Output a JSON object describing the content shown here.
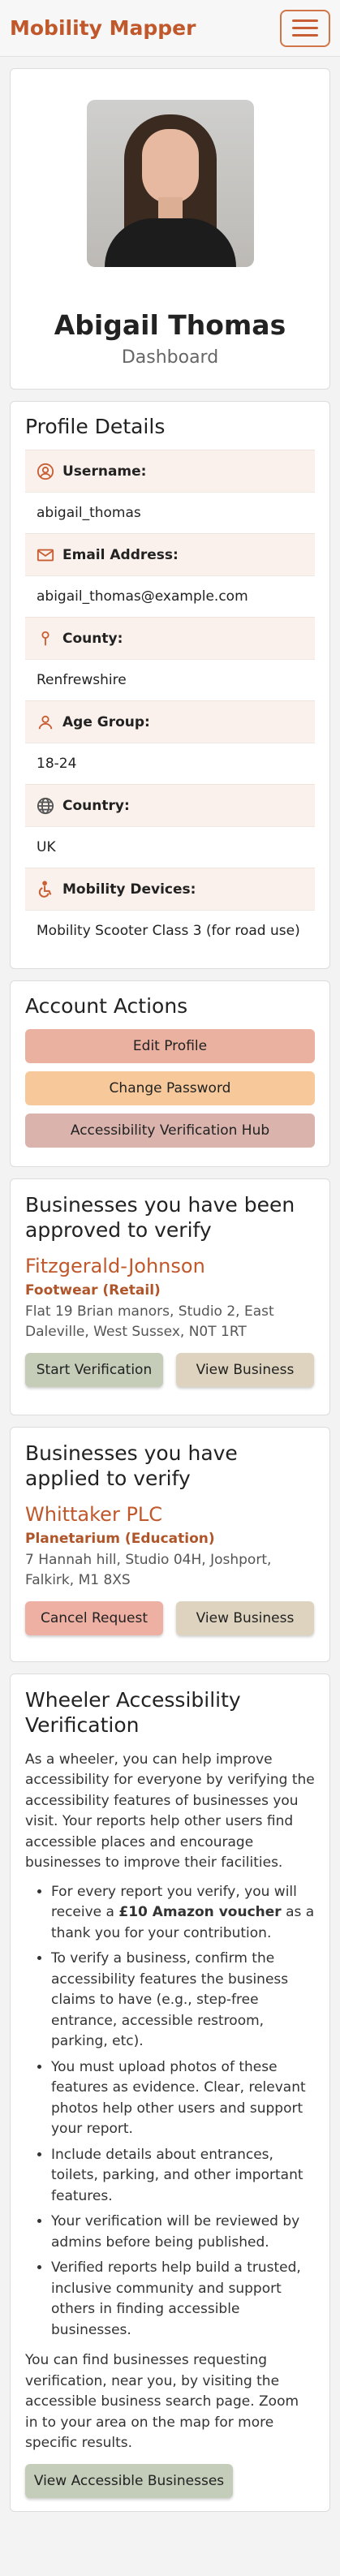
{
  "navbar": {
    "brand": "Mobility Mapper",
    "menu_icon": "hamburger-icon"
  },
  "profile": {
    "name": "Abigail Thomas",
    "subtitle": "Dashboard"
  },
  "details": {
    "title": "Profile Details",
    "fields": [
      {
        "label": "Username:",
        "value": "abigail_thomas",
        "icon": "user-circle-icon"
      },
      {
        "label": "Email Address:",
        "value": "abigail_thomas@example.com",
        "icon": "envelope-icon"
      },
      {
        "label": "County:",
        "value": "Renfrewshire",
        "icon": "map-pin-icon"
      },
      {
        "label": "Age Group:",
        "value": "18-24",
        "icon": "person-icon"
      },
      {
        "label": "Country:",
        "value": "UK",
        "icon": "globe-icon"
      },
      {
        "label": "Mobility Devices:",
        "value": "Mobility Scooter Class 3 (for road use)",
        "icon": "wheelchair-icon"
      }
    ]
  },
  "actions": {
    "title": "Account Actions",
    "edit": "Edit Profile",
    "password": "Change Password",
    "hub": "Accessibility Verification Hub"
  },
  "approved": {
    "title": "Businesses you have been approved to verify",
    "name": "Fitzgerald-Johnson",
    "category": "Footwear (Retail)",
    "address": "Flat 19 Brian manors, Studio 2, East Daleville, West Sussex, N0T 1RT",
    "start": "Start Verification",
    "view": "View Business"
  },
  "applied": {
    "title": "Businesses you have applied to verify",
    "name": "Whittaker PLC",
    "category": "Planetarium (Education)",
    "address": "7 Hannah hill, Studio 04H, Joshport, Falkirk, M1 8XS",
    "cancel": "Cancel Request",
    "view": "View Business"
  },
  "wheeler": {
    "title": "Wheeler Accessibility Verification",
    "intro": "As a wheeler, you can help improve accessibility for everyone by verifying the accessibility features of businesses you visit. Your reports help other users find accessible places and encourage businesses to improve their facilities.",
    "bullet1_pre": "For every report you verify, you will receive a ",
    "bullet1_bold": "£10 Amazon voucher",
    "bullet1_post": " as a thank you for your contribution.",
    "bullet2": "To verify a business, confirm the accessibility features the business claims to have (e.g., step-free entrance, accessible restroom, parking, etc).",
    "bullet3": "You must upload photos of these features as evidence. Clear, relevant photos help other users and support your report.",
    "bullet4": "Include details about entrances, toilets, parking, and other important features.",
    "bullet5": "Your verification will be reviewed by admins before being published.",
    "bullet6": "Verified reports help build a trusted, inclusive community and support others in finding accessible businesses.",
    "outro": "You can find businesses requesting verification, near you, by visiting the accessible business search page. Zoom in to your area on the map for more specific results.",
    "button": "View Accessible Businesses"
  },
  "colors": {
    "brand": "#c0582b",
    "label_bg": "#fbf1ec"
  }
}
